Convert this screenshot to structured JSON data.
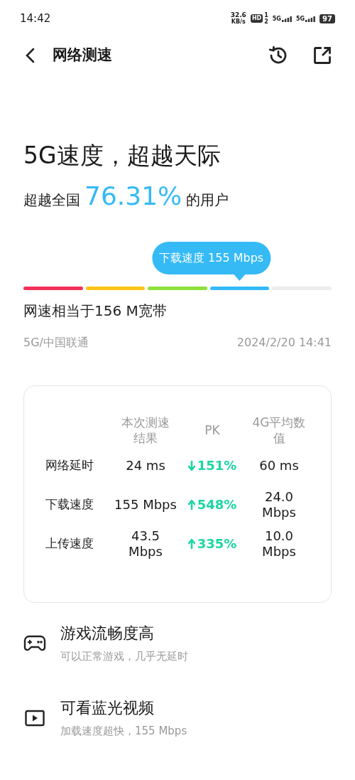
{
  "status_bar": {
    "time": "14:42",
    "net_speed": "32.6",
    "net_unit": "KB/s",
    "hd_label": "HD",
    "hd_sup": "1",
    "hd_sub": "2",
    "sim1": "5G",
    "sim2": "5G",
    "battery": "97"
  },
  "header": {
    "title": "网络测速"
  },
  "headline": "5G速度，超越天际",
  "rank": {
    "prefix": "超越全国",
    "percent": "76.31%",
    "suffix": "的用户"
  },
  "speed_bar": {
    "tooltip": "下载速度 155 Mbps",
    "segments": [
      {
        "kind": "range",
        "color": "#f0325a"
      },
      {
        "kind": "range",
        "color": "#fcc419"
      },
      {
        "kind": "range",
        "color": "#8ee03a"
      },
      {
        "kind": "current",
        "color": "#35baf6"
      },
      {
        "kind": "range",
        "color": "#ececec"
      }
    ]
  },
  "broadband": "网速相当于156 M宽带",
  "carrier": "5G/中国联通",
  "timestamp": "2024/2/20 14:41",
  "comparison": {
    "columns": [
      "本次测速结果",
      "PK",
      "4G平均数值"
    ],
    "rows": [
      {
        "label": "网络延时",
        "current": "24 ms",
        "kind": "down",
        "pk": "151%",
        "average": "60 ms"
      },
      {
        "label": "下载速度",
        "current": "155 Mbps",
        "kind": "up",
        "pk": "548%",
        "average": "24.0 Mbps"
      },
      {
        "label": "上传速度",
        "current": "43.5 Mbps",
        "kind": "up",
        "pk": "335%",
        "average": "10.0 Mbps"
      }
    ]
  },
  "features": [
    {
      "kind": "game",
      "title": "游戏流畅度高",
      "subtitle": "可以正常游戏，几乎无延时"
    },
    {
      "kind": "video",
      "title": "可看蓝光视频",
      "subtitle": "加载速度超快，155 Mbps"
    }
  ]
}
